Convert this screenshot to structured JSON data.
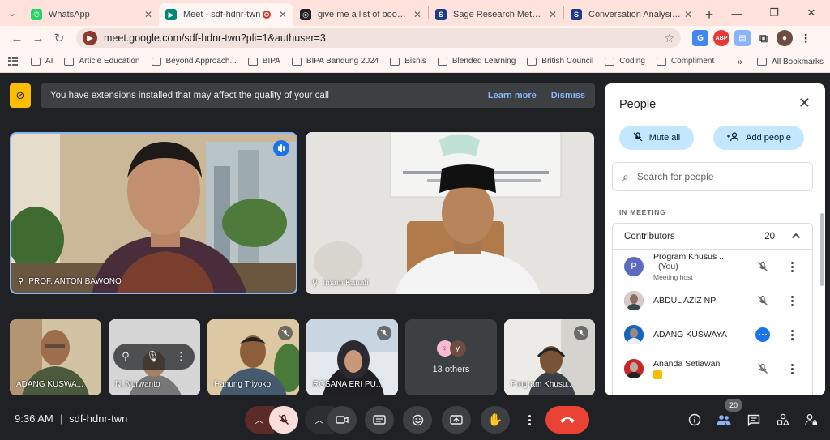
{
  "browser": {
    "tabs": [
      {
        "title": "WhatsApp",
        "color": "#25d366",
        "glyph": "✆"
      },
      {
        "title": "Meet - sdf-hdnr-twn",
        "color": "#00897b",
        "glyph": "▶"
      },
      {
        "title": "give me a list of books on d",
        "color": "#202124",
        "glyph": "◎"
      },
      {
        "title": "Sage Research Methods - C",
        "color": "#1e3a8a",
        "glyph": "S"
      },
      {
        "title": "Conversation Analysis and D",
        "color": "#1e3a8a",
        "glyph": "S"
      }
    ],
    "url": "meet.google.com/sdf-hdnr-twn?pli=1&authuser=3",
    "bookmarks": [
      "AI",
      "Article Education",
      "Beyond Approach...",
      "BIPA",
      "BIPA Bandung 2024",
      "Bisnis",
      "Blended Learning",
      "British Council",
      "Coding",
      "Compliment"
    ],
    "all_bookmarks": "All Bookmarks",
    "abp": "ABP"
  },
  "banner": {
    "message": "You have extensions installed that may affect the quality of your call",
    "learn_more": "Learn more",
    "dismiss": "Dismiss"
  },
  "tiles": {
    "main": [
      {
        "name": "PROF. ANTON BAWONO"
      },
      {
        "name": "Imam Kanafi"
      }
    ],
    "thumbs": [
      {
        "name": "ADANG KUSWA..."
      },
      {
        "name": "N. Norwanto"
      },
      {
        "name": "Hanung Triyoko"
      },
      {
        "name": "ROSANA ERI PU..."
      },
      {
        "name": "Program Khusu..."
      }
    ],
    "others": {
      "label": "13 others",
      "avatar1": "",
      "avatar2": "y"
    }
  },
  "panel": {
    "title": "People",
    "mute_all": "Mute all",
    "add_people": "Add people",
    "search_placeholder": "Search for people",
    "section": "IN MEETING",
    "group_label": "Contributors",
    "group_count": "20",
    "people": [
      {
        "name": "Program Khusus ...",
        "suffix": "(You)",
        "sub": "Meeting host",
        "avatar": "P",
        "color": "#5c6bc0"
      },
      {
        "name": "ABDUL AZIZ NP",
        "suffix": "",
        "sub": "",
        "avatar": "",
        "color": "#6d4c41"
      },
      {
        "name": "ADANG KUSWAYA",
        "suffix": "",
        "sub": "",
        "avatar": "",
        "color": "#8d6e63"
      },
      {
        "name": "Ananda Setiawan",
        "suffix": "",
        "sub": "",
        "avatar": "",
        "color": "#a1887f"
      }
    ]
  },
  "bottom": {
    "time": "9:36 AM",
    "meeting_code": "sdf-hdnr-twn",
    "people_count": "20"
  }
}
